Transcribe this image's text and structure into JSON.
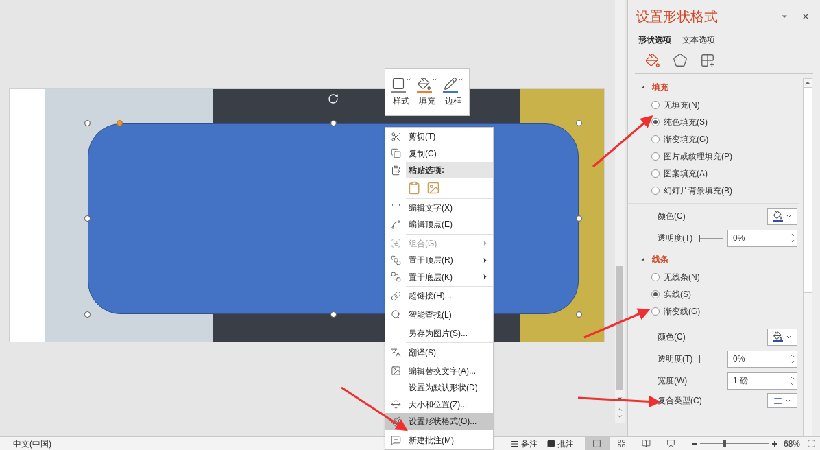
{
  "mini_toolbar": [
    {
      "label": "样式"
    },
    {
      "label": "填充"
    },
    {
      "label": "边框"
    }
  ],
  "context_menu": [
    {
      "kind": "item",
      "label": "剪切(T)",
      "disabled": false,
      "submenu": false,
      "selected": false
    },
    {
      "kind": "item",
      "label": "复制(C)",
      "disabled": false,
      "submenu": false,
      "selected": false
    },
    {
      "kind": "header",
      "label": "粘贴选项:"
    },
    {
      "kind": "paste_options"
    },
    {
      "kind": "separator"
    },
    {
      "kind": "item",
      "label": "编辑文字(X)",
      "disabled": false,
      "submenu": false,
      "selected": false
    },
    {
      "kind": "item",
      "label": "编辑顶点(E)",
      "disabled": false,
      "submenu": false,
      "selected": false
    },
    {
      "kind": "separator"
    },
    {
      "kind": "item",
      "label": "组合(G)",
      "disabled": true,
      "submenu": true,
      "selected": false
    },
    {
      "kind": "item",
      "label": "置于顶层(R)",
      "disabled": false,
      "submenu": true,
      "selected": false
    },
    {
      "kind": "item",
      "label": "置于底层(K)",
      "disabled": false,
      "submenu": true,
      "selected": false
    },
    {
      "kind": "separator"
    },
    {
      "kind": "item",
      "label": "超链接(H)...",
      "disabled": false,
      "submenu": false,
      "selected": false
    },
    {
      "kind": "separator"
    },
    {
      "kind": "item",
      "label": "智能查找(L)",
      "disabled": false,
      "submenu": false,
      "selected": false
    },
    {
      "kind": "separator"
    },
    {
      "kind": "item",
      "label": "另存为图片(S)...",
      "disabled": false,
      "submenu": false,
      "selected": false
    },
    {
      "kind": "separator"
    },
    {
      "kind": "item",
      "label": "翻译(S)",
      "disabled": false,
      "submenu": false,
      "selected": false
    },
    {
      "kind": "separator"
    },
    {
      "kind": "item",
      "label": "编辑替换文字(A)...",
      "disabled": false,
      "submenu": false,
      "selected": false
    },
    {
      "kind": "item",
      "label": "设置为默认形状(D)",
      "disabled": false,
      "submenu": false,
      "selected": false
    },
    {
      "kind": "item",
      "label": "大小和位置(Z)...",
      "disabled": false,
      "submenu": false,
      "selected": false
    },
    {
      "kind": "item",
      "label": "设置形状格式(O)...",
      "disabled": false,
      "submenu": false,
      "selected": true
    },
    {
      "kind": "separator"
    },
    {
      "kind": "item",
      "label": "新建批注(M)",
      "disabled": false,
      "submenu": false,
      "selected": false
    }
  ],
  "format_pane": {
    "title": "设置形状格式",
    "tabs": [
      {
        "label": "形状选项",
        "selected": true
      },
      {
        "label": "文本选项",
        "selected": false
      }
    ],
    "icon_tabs": [
      {
        "selected": true
      },
      {
        "selected": false
      },
      {
        "selected": false
      }
    ],
    "sections": [
      {
        "title": "填充",
        "expanded": true,
        "options": [
          {
            "label": "无填充(N)",
            "selected": false
          },
          {
            "label": "纯色填充(S)",
            "selected": true
          },
          {
            "label": "渐变填充(G)",
            "selected": false
          },
          {
            "label": "图片或纹理填充(P)",
            "selected": false
          },
          {
            "label": "图案填充(A)",
            "selected": false
          },
          {
            "label": "幻灯片背景填充(B)",
            "selected": false
          }
        ],
        "rows": [
          {
            "kind": "color",
            "label": "颜色(C)"
          },
          {
            "kind": "slider",
            "label": "透明度(T)",
            "level": 0,
            "value": "0%"
          }
        ]
      },
      {
        "title": "线条",
        "expanded": true,
        "options": [
          {
            "label": "无线条(N)",
            "selected": false
          },
          {
            "label": "实线(S)",
            "selected": true
          },
          {
            "label": "渐变线(G)",
            "selected": false
          }
        ],
        "rows": [
          {
            "kind": "color",
            "label": "颜色(C)"
          },
          {
            "kind": "slider",
            "label": "透明度(T)",
            "level": 0,
            "value": "0%"
          },
          {
            "kind": "spin",
            "label": "宽度(W)",
            "value": "1 磅"
          },
          {
            "kind": "dropdown",
            "label": "复合类型(C)"
          }
        ]
      }
    ]
  },
  "status_bar": {
    "language": "中文(中国)",
    "notes": "备注",
    "comments": "批注",
    "views": [
      {
        "selected": true
      },
      {
        "selected": false
      },
      {
        "selected": false
      },
      {
        "selected": false
      }
    ],
    "zoom": {
      "level": 0.35,
      "value": "68%"
    }
  }
}
